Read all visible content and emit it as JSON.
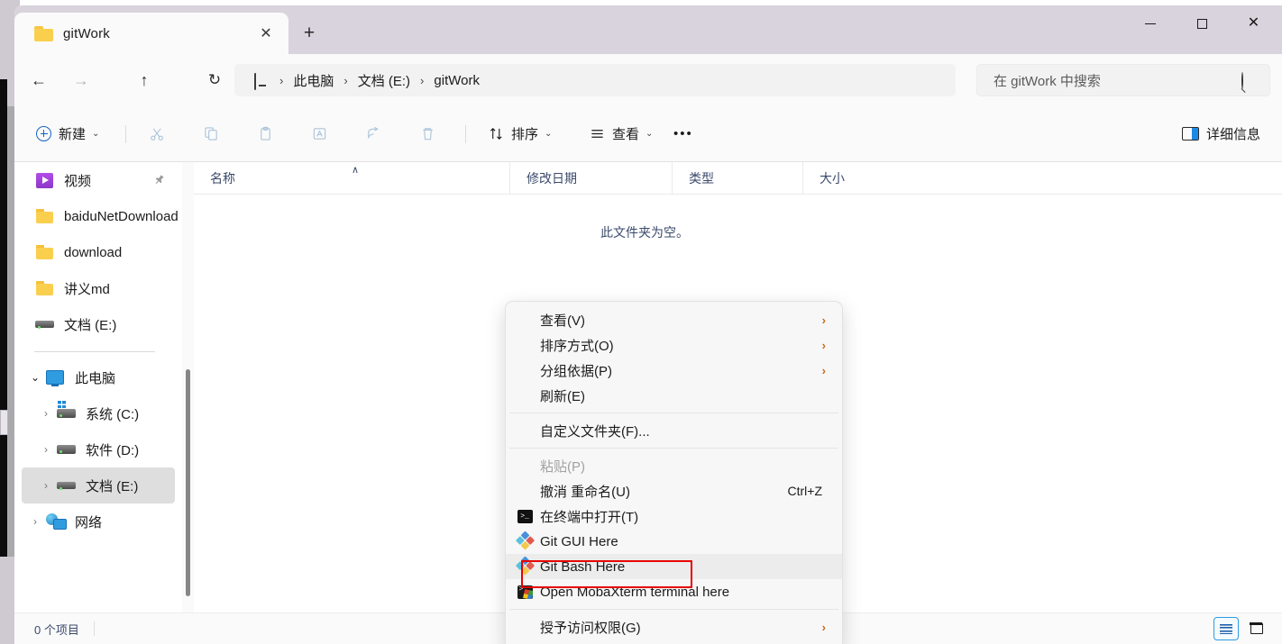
{
  "window": {
    "tab_title": "gitWork",
    "tab_folder_icon": "folder-icon",
    "close_tab_glyph": "✕",
    "new_tab_glyph": "+",
    "minimize_glyph": "",
    "maximize_glyph": "",
    "close_glyph": "✕"
  },
  "nav": {
    "back_glyph": "←",
    "forward_glyph": "→",
    "up_glyph": "↑",
    "refresh_glyph": "↻",
    "breadcrumb_icon": "this-pc-icon",
    "breadcrumbs": [
      "此电脑",
      "文档 (E:)",
      "gitWork"
    ],
    "separator": "›"
  },
  "search": {
    "placeholder": "在 gitWork 中搜索",
    "icon": "search-icon"
  },
  "toolbar": {
    "new_label": "新建",
    "new_chevron": "⌄",
    "cut_icon": "scissors-icon",
    "copy_icon": "copy-icon",
    "paste_icon": "paste-icon",
    "rename_icon": "rename-icon",
    "share_icon": "share-icon",
    "delete_icon": "trash-icon",
    "sort_label": "排序",
    "sort_icon": "sort-arrows-icon",
    "sort_chevron": "⌄",
    "view_label": "查看",
    "view_icon": "view-lines-icon",
    "view_chevron": "⌄",
    "more_label": "•••",
    "details_label": "详细信息",
    "details_icon": "details-pane-icon"
  },
  "sidebar": {
    "items": [
      {
        "label": "视频",
        "icon": "video-folder-icon",
        "pinned": true,
        "chevron": "",
        "indent": 0,
        "selected": false
      },
      {
        "label": "baiduNetDownload",
        "icon": "folder-icon",
        "pinned": false,
        "chevron": "",
        "indent": 0,
        "selected": false
      },
      {
        "label": "download",
        "icon": "folder-icon",
        "pinned": false,
        "chevron": "",
        "indent": 0,
        "selected": false
      },
      {
        "label": "讲义md",
        "icon": "folder-icon",
        "pinned": false,
        "chevron": "",
        "indent": 0,
        "selected": false
      },
      {
        "label": "文档 (E:)",
        "icon": "drive-icon",
        "pinned": false,
        "chevron": "",
        "indent": 0,
        "selected": false
      },
      {
        "label": "此电脑",
        "icon": "this-pc-icon",
        "pinned": false,
        "chevron": "⌄",
        "indent": 0,
        "selected": false
      },
      {
        "label": "系统 (C:)",
        "icon": "system-drive-icon",
        "pinned": false,
        "chevron": "›",
        "indent": 1,
        "selected": false
      },
      {
        "label": "软件 (D:)",
        "icon": "drive-icon",
        "pinned": false,
        "chevron": "›",
        "indent": 1,
        "selected": false
      },
      {
        "label": "文档 (E:)",
        "icon": "drive-icon",
        "pinned": false,
        "chevron": "›",
        "indent": 1,
        "selected": true
      },
      {
        "label": "网络",
        "icon": "network-icon",
        "pinned": false,
        "chevron": "›",
        "indent": 0,
        "selected": false
      }
    ],
    "pin_glyph": "📌"
  },
  "columns": {
    "headers": [
      "名称",
      "修改日期",
      "类型",
      "大小"
    ],
    "sort_caret": "∧"
  },
  "content": {
    "empty_message": "此文件夹为空。"
  },
  "status": {
    "item_count": "0 个项目",
    "view_details_icon": "details-view-icon",
    "view_tiles_icon": "large-icons-view-icon"
  },
  "context_menu": {
    "items": [
      {
        "type": "item",
        "label": "查看(V)",
        "icon": "",
        "accel": "",
        "arrow": "›",
        "state": "normal"
      },
      {
        "type": "item",
        "label": "排序方式(O)",
        "icon": "",
        "accel": "",
        "arrow": "›",
        "state": "normal"
      },
      {
        "type": "item",
        "label": "分组依据(P)",
        "icon": "",
        "accel": "",
        "arrow": "›",
        "state": "normal"
      },
      {
        "type": "item",
        "label": "刷新(E)",
        "icon": "",
        "accel": "",
        "arrow": "",
        "state": "normal"
      },
      {
        "type": "divider"
      },
      {
        "type": "item",
        "label": "自定义文件夹(F)...",
        "icon": "",
        "accel": "",
        "arrow": "",
        "state": "normal"
      },
      {
        "type": "divider"
      },
      {
        "type": "item",
        "label": "粘贴(P)",
        "icon": "",
        "accel": "",
        "arrow": "",
        "state": "disabled"
      },
      {
        "type": "item",
        "label": "撤消 重命名(U)",
        "icon": "",
        "accel": "Ctrl+Z",
        "arrow": "",
        "state": "normal"
      },
      {
        "type": "item",
        "label": "在终端中打开(T)",
        "icon": "terminal-icon",
        "accel": "",
        "arrow": "",
        "state": "normal"
      },
      {
        "type": "item",
        "label": "Git GUI Here",
        "icon": "git-icon",
        "accel": "",
        "arrow": "",
        "state": "normal"
      },
      {
        "type": "item",
        "label": "Git Bash Here",
        "icon": "git-icon",
        "accel": "",
        "arrow": "",
        "state": "highlighted"
      },
      {
        "type": "item",
        "label": "Open MobaXterm terminal here",
        "icon": "mobaxterm-icon",
        "accel": "",
        "arrow": "",
        "state": "normal"
      },
      {
        "type": "divider"
      },
      {
        "type": "item",
        "label": "授予访问权限(G)",
        "icon": "",
        "accel": "",
        "arrow": "›",
        "state": "normal"
      },
      {
        "type": "divider"
      }
    ],
    "highlight_box_color": "#e60000"
  }
}
